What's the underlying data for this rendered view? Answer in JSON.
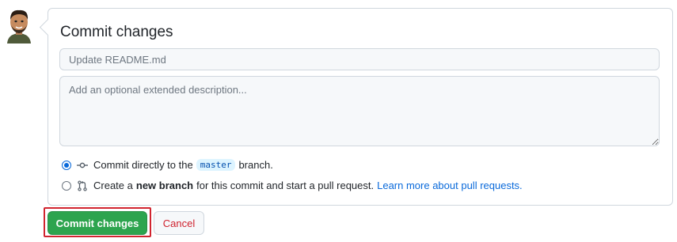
{
  "user": {
    "avatar_icon": "bitmoji-avatar-icon"
  },
  "commit_form": {
    "title": "Commit changes",
    "summary": {
      "value": "",
      "placeholder": "Update README.md"
    },
    "description": {
      "value": "",
      "placeholder": "Add an optional extended description..."
    },
    "options": {
      "direct": {
        "selected": true,
        "icon": "git-commit-icon",
        "text_before": "Commit directly to the",
        "branch": "master",
        "text_after": "branch."
      },
      "new_branch": {
        "selected": false,
        "icon": "git-pull-request-icon",
        "text_before": "Create a",
        "bold_text": "new branch",
        "text_after": "for this commit and start a pull request.",
        "link_text": "Learn more about pull requests."
      }
    },
    "buttons": {
      "commit": "Commit changes",
      "cancel": "Cancel"
    }
  },
  "colors": {
    "commit_button": "#2da44e",
    "cancel_text": "#cf222e",
    "link": "#0969da",
    "highlight_box": "#d1242f",
    "branch_badge_bg": "#ddf4ff"
  }
}
